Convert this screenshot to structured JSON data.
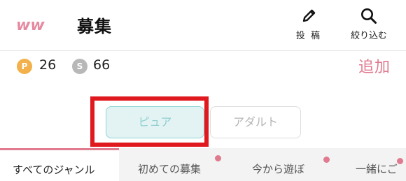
{
  "header": {
    "logo_text": "ww",
    "title": "募集",
    "post_label": "投 稿",
    "filter_label": "絞り込む"
  },
  "points": {
    "p_badge": "P",
    "p_value": "26",
    "s_badge": "S",
    "s_value": "66",
    "add_label": "追加"
  },
  "category_toggle": {
    "options": [
      "ピュア",
      "アダルト"
    ],
    "selected": "ピュア"
  },
  "genre_tabs": [
    {
      "label": "すべてのジャンル",
      "active": true
    },
    {
      "label": "初めての募集",
      "new_dot": true
    },
    {
      "label": "今から遊ぼ",
      "new_dot": true
    },
    {
      "label": "一緒にご",
      "new_dot": true
    }
  ],
  "colors": {
    "accent_pink": "#e07a8f",
    "pure_teal": "#8fd3d3",
    "highlight_red": "#e0191f",
    "coin_p": "#f2b14a",
    "coin_s": "#b8b8b8"
  },
  "icons": {
    "logo": "ww-logo",
    "post": "pencil-icon",
    "filter": "search-icon"
  }
}
